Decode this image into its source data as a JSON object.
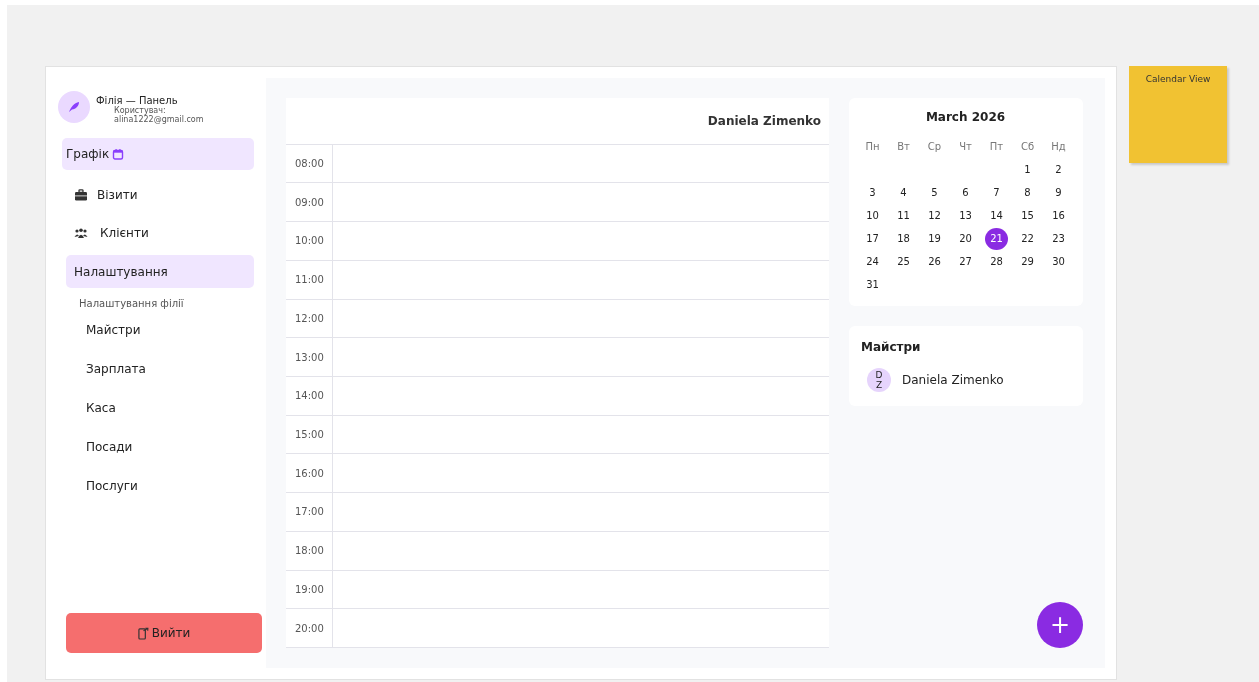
{
  "sidebar": {
    "title": "Філія — Панель",
    "user_label": "Користувач:",
    "user_email": "alina1222@gmail.com",
    "items": [
      {
        "label": "Графік",
        "kind": "calendar",
        "selected": true
      },
      {
        "label": "Візити",
        "kind": "briefcase",
        "selected": false
      },
      {
        "label": "Клієнти",
        "kind": "people",
        "selected": false
      }
    ],
    "settings": {
      "label": "Налаштування",
      "expanded": true,
      "heading": "Налаштування філії",
      "children": [
        {
          "label": "Майстри"
        },
        {
          "label": "Зарплата"
        },
        {
          "label": "Каса"
        },
        {
          "label": "Посади"
        },
        {
          "label": "Послуги"
        }
      ]
    },
    "logout": "Вийти"
  },
  "schedule": {
    "columns": [
      "Daniela Zimenko"
    ],
    "times": [
      "08:00",
      "09:00",
      "10:00",
      "11:00",
      "12:00",
      "13:00",
      "14:00",
      "15:00",
      "16:00",
      "17:00",
      "18:00",
      "19:00",
      "20:00"
    ]
  },
  "calendar": {
    "title": "March 2026",
    "weekdays": [
      "Пн",
      "Вт",
      "Ср",
      "Чт",
      "Пт",
      "Сб",
      "Нд"
    ],
    "weeks": [
      {
        "days": [
          {
            "kind": "blank"
          },
          {
            "kind": "blank"
          },
          {
            "kind": "blank"
          },
          {
            "kind": "blank"
          },
          {
            "kind": "blank"
          },
          {
            "label": "1",
            "selected": false
          },
          {
            "label": "2",
            "selected": false
          }
        ]
      },
      {
        "days": [
          {
            "label": "3",
            "selected": false
          },
          {
            "label": "4",
            "selected": false
          },
          {
            "label": "5",
            "selected": false
          },
          {
            "label": "6",
            "selected": false
          },
          {
            "label": "7",
            "selected": false
          },
          {
            "label": "8",
            "selected": false
          },
          {
            "label": "9",
            "selected": false
          }
        ]
      },
      {
        "days": [
          {
            "label": "10",
            "selected": false
          },
          {
            "label": "11",
            "selected": false
          },
          {
            "label": "12",
            "selected": false
          },
          {
            "label": "13",
            "selected": false
          },
          {
            "label": "14",
            "selected": false
          },
          {
            "label": "15",
            "selected": false
          },
          {
            "label": "16",
            "selected": false
          }
        ]
      },
      {
        "days": [
          {
            "label": "17",
            "selected": false
          },
          {
            "label": "18",
            "selected": false
          },
          {
            "label": "19",
            "selected": false
          },
          {
            "label": "20",
            "selected": false
          },
          {
            "label": "21",
            "selected": true
          },
          {
            "label": "22",
            "selected": false
          },
          {
            "label": "23",
            "selected": false
          }
        ]
      },
      {
        "days": [
          {
            "label": "24",
            "selected": false
          },
          {
            "label": "25",
            "selected": false
          },
          {
            "label": "26",
            "selected": false
          },
          {
            "label": "27",
            "selected": false
          },
          {
            "label": "28",
            "selected": false
          },
          {
            "label": "29",
            "selected": false
          },
          {
            "label": "30",
            "selected": false
          }
        ]
      },
      {
        "days": [
          {
            "label": "31",
            "selected": false
          }
        ]
      }
    ]
  },
  "masters": {
    "title": "Майстри",
    "items": [
      {
        "initials": "D Z",
        "name": "Daniela Zimenko"
      }
    ]
  },
  "fab": "+",
  "sticky_note": {
    "text": "Calendar View"
  }
}
